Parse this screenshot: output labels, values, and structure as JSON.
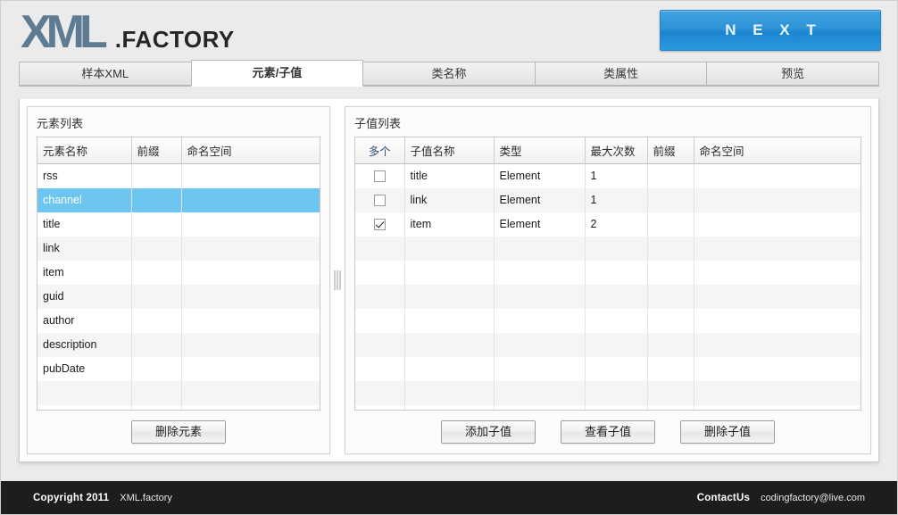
{
  "brand": {
    "logo_primary": "XML",
    "logo_secondary": ".FACTORY",
    "logo_color": "#5d7c94"
  },
  "header": {
    "next_label": "N E X T",
    "next_color": "#2e93d8"
  },
  "tabs": [
    {
      "label": "样本XML",
      "active": false
    },
    {
      "label": "元素/子值",
      "active": true
    },
    {
      "label": "类名称",
      "active": false
    },
    {
      "label": "类属性",
      "active": false
    },
    {
      "label": "预览",
      "active": false
    }
  ],
  "left_panel": {
    "title": "元素列表",
    "columns": [
      "元素名称",
      "前缀",
      "命名空间"
    ],
    "rows": [
      {
        "name": "rss",
        "prefix": "",
        "namespace": "",
        "selected": false
      },
      {
        "name": "channel",
        "prefix": "",
        "namespace": "",
        "selected": true
      },
      {
        "name": "title",
        "prefix": "",
        "namespace": "",
        "selected": false
      },
      {
        "name": "link",
        "prefix": "",
        "namespace": "",
        "selected": false
      },
      {
        "name": "item",
        "prefix": "",
        "namespace": "",
        "selected": false
      },
      {
        "name": "guid",
        "prefix": "",
        "namespace": "",
        "selected": false
      },
      {
        "name": "author",
        "prefix": "",
        "namespace": "",
        "selected": false
      },
      {
        "name": "description",
        "prefix": "",
        "namespace": "",
        "selected": false
      },
      {
        "name": "pubDate",
        "prefix": "",
        "namespace": "",
        "selected": false
      }
    ],
    "empty_rows": 2,
    "selection_color": "#6ec6f0",
    "buttons": [
      {
        "label": "删除元素",
        "name": "delete-element-button"
      }
    ]
  },
  "right_panel": {
    "title": "子值列表",
    "columns": [
      "多个",
      "子值名称",
      "类型",
      "最大次数",
      "前缀",
      "命名空间"
    ],
    "header_accent_color": "#33507a",
    "rows": [
      {
        "multi": false,
        "name": "title",
        "type": "Element",
        "max_count": "1",
        "prefix": "",
        "namespace": ""
      },
      {
        "multi": false,
        "name": "link",
        "type": "Element",
        "max_count": "1",
        "prefix": "",
        "namespace": ""
      },
      {
        "multi": true,
        "name": "item",
        "type": "Element",
        "max_count": "2",
        "prefix": "",
        "namespace": ""
      }
    ],
    "empty_rows": 8,
    "buttons": [
      {
        "label": "添加子值",
        "name": "add-subvalue-button"
      },
      {
        "label": "查看子值",
        "name": "view-subvalue-button"
      },
      {
        "label": "删除子值",
        "name": "delete-subvalue-button"
      }
    ]
  },
  "footer": {
    "copyright": "Copyright 2011",
    "product": "XML.factory",
    "contact_label": "ContactUs",
    "contact_email": "codingfactory@live.com"
  }
}
